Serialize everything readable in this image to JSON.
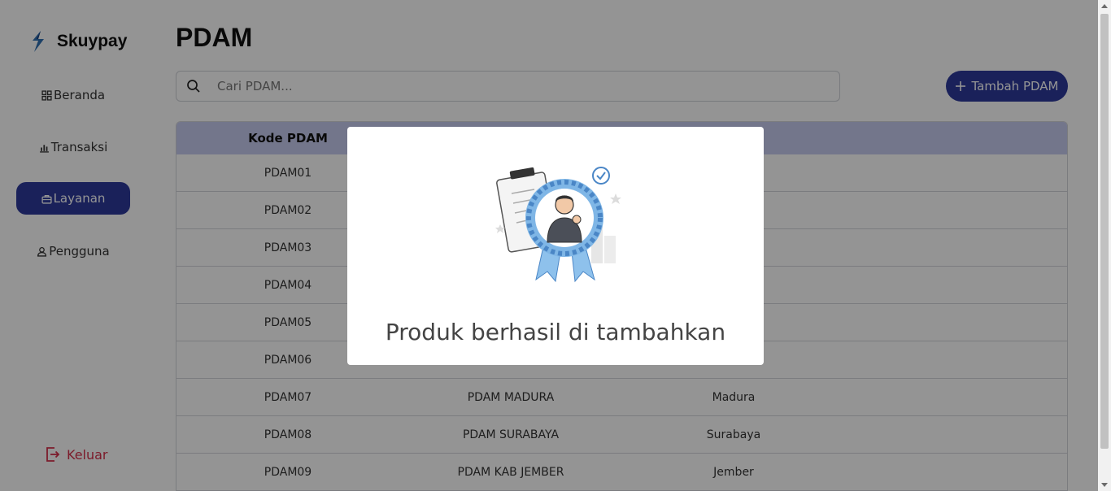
{
  "app": {
    "name": "Skuypay"
  },
  "sidebar": {
    "items": [
      {
        "label": "Beranda",
        "icon": "grid-icon"
      },
      {
        "label": "Transaksi",
        "icon": "bar-chart-icon"
      },
      {
        "label": "Layanan",
        "icon": "briefcase-icon",
        "active": true
      },
      {
        "label": "Pengguna",
        "icon": "user-icon"
      }
    ],
    "logout_label": "Keluar"
  },
  "main": {
    "title": "PDAM",
    "search_placeholder": "Cari PDAM...",
    "add_button_label": "Tambah PDAM",
    "table": {
      "headers": [
        "Kode PDAM",
        "",
        ""
      ],
      "rows": [
        [
          "PDAM01",
          "",
          ""
        ],
        [
          "PDAM02",
          "",
          ""
        ],
        [
          "PDAM03",
          "",
          ""
        ],
        [
          "PDAM04",
          "",
          ""
        ],
        [
          "PDAM05",
          "",
          ""
        ],
        [
          "PDAM06",
          "",
          ""
        ],
        [
          "PDAM07",
          "PDAM MADURA",
          "Madura"
        ],
        [
          "PDAM08",
          "PDAM SURABAYA",
          "Surabaya"
        ],
        [
          "PDAM09",
          "PDAM KAB JEMBER",
          "Jember"
        ]
      ]
    }
  },
  "modal": {
    "message": "Produk berhasil di tambahkan",
    "illustration": "award-ribbon-illustration"
  },
  "colors": {
    "primary": "#2d3a9c",
    "danger": "#d6304a",
    "table_header": "#c7cbef",
    "overlay": "rgba(0,0,0,0.42)"
  }
}
